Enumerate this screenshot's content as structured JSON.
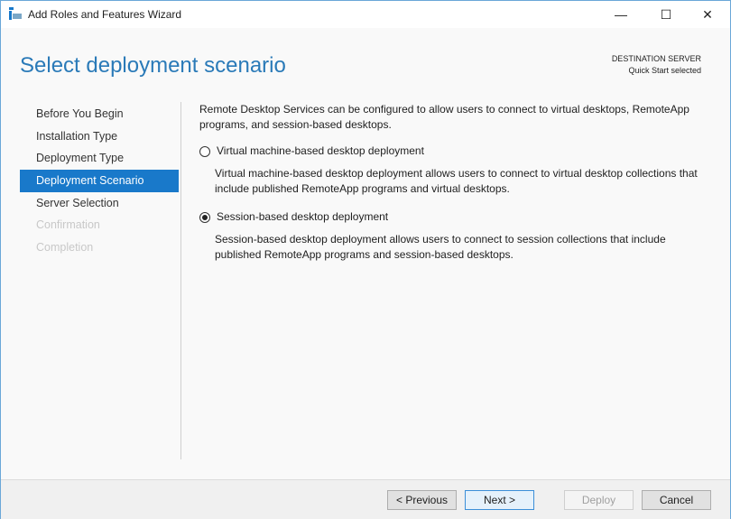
{
  "window": {
    "title": "Add Roles and Features Wizard",
    "minimize": "—",
    "maximize": "☐",
    "close": "✕"
  },
  "header": {
    "title": "Select deployment scenario",
    "dest_label": "DESTINATION SERVER",
    "dest_value": "Quick Start selected"
  },
  "nav": [
    "Before You Begin",
    "Installation Type",
    "Deployment Type",
    "Deployment Scenario",
    "Server Selection",
    "Confirmation",
    "Completion"
  ],
  "content": {
    "intro": "Remote Desktop Services can be configured to allow users to connect to virtual desktops, RemoteApp programs, and session-based desktops.",
    "options": [
      {
        "label": "Virtual machine-based desktop deployment",
        "desc": "Virtual machine-based desktop deployment allows users to connect to virtual desktop collections that include published RemoteApp programs and virtual desktops.",
        "selected": false
      },
      {
        "label": "Session-based desktop deployment",
        "desc": "Session-based desktop deployment allows users to connect to session collections that include published RemoteApp programs and session-based desktops.",
        "selected": true
      }
    ]
  },
  "buttons": {
    "previous": "< Previous",
    "next": "Next >",
    "deploy": "Deploy",
    "cancel": "Cancel"
  }
}
